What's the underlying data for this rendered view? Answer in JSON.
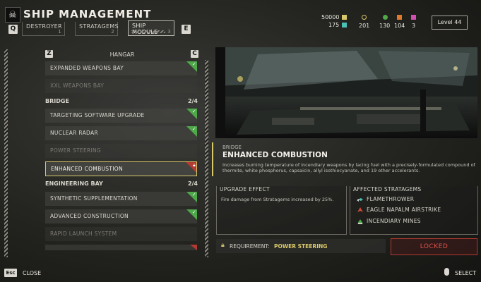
{
  "header": {
    "title": "SHIP MANAGEMENT",
    "logo_icon": "skull-icon",
    "prev_key": "Q",
    "next_key": "E",
    "tabs": [
      {
        "label": "DESTROYER",
        "num": "1"
      },
      {
        "label": "STRATAGEMS",
        "num": "2"
      },
      {
        "label": "SHIP MODULE",
        "num": "3",
        "active": true
      }
    ]
  },
  "resources": {
    "requisition": "50000",
    "medals": "175",
    "samples_common": "201",
    "samples_green": "130",
    "samples_orange": "104",
    "samples_pink": "3",
    "level": "Level 44",
    "colors": {
      "yellow": "#d9c86a",
      "teal": "#4bc0b5",
      "green": "#4fa84a",
      "orange": "#e07a2a",
      "pink": "#d24fb0"
    }
  },
  "list": {
    "left_key": "Z",
    "right_key": "C",
    "header": "HANGAR",
    "hangar_items": [
      {
        "label": "EXPANDED WEAPONS BAY",
        "status": "unlocked"
      },
      {
        "label": "XXL WEAPONS BAY",
        "status": "unavailable"
      }
    ],
    "bridge": {
      "label": "BRIDGE",
      "count": "2/4",
      "items": [
        {
          "label": "TARGETING SOFTWARE UPGRADE",
          "status": "unlocked"
        },
        {
          "label": "NUCLEAR RADAR",
          "status": "unlocked"
        },
        {
          "label": "POWER STEERING",
          "status": "unavailable"
        },
        {
          "label": "ENHANCED COMBUSTION",
          "status": "locked"
        }
      ]
    },
    "engineering": {
      "label": "ENGINEERING BAY",
      "count": "2/4",
      "items": [
        {
          "label": "SYNTHETIC SUPPLEMENTATION",
          "status": "unlocked"
        },
        {
          "label": "ADVANCED CONSTRUCTION",
          "status": "unlocked"
        },
        {
          "label": "RAPID LAUNCH SYSTEM",
          "status": "unavailable"
        }
      ]
    }
  },
  "detail": {
    "category": "BRIDGE",
    "title": "ENHANCED COMBUSTION",
    "description": "Increases burning temperature of incendiary weapons by lacing fuel with a precisely-formulated compound of thermite, white phosphorus, capsaicin, allyl isothiocyanate, and 19 other accelerants.",
    "effect_header": "UPGRADE EFFECT",
    "effect_text": "Fire damage from Stratagems increased by 25%.",
    "affected_header": "AFFECTED STRATAGEMS",
    "stratagems": [
      {
        "label": "FLAMETHROWER",
        "icon": "flamethrower-icon"
      },
      {
        "label": "EAGLE NAPALM AIRSTRIKE",
        "icon": "eagle-icon"
      },
      {
        "label": "INCENDIARY MINES",
        "icon": "mine-icon"
      }
    ],
    "requirement_label": "REQUIREMENT:",
    "requirement_value": "POWER STEERING",
    "locked_label": "LOCKED"
  },
  "footer": {
    "close_key": "Esc",
    "close_label": "CLOSE",
    "select_label": "SELECT"
  }
}
